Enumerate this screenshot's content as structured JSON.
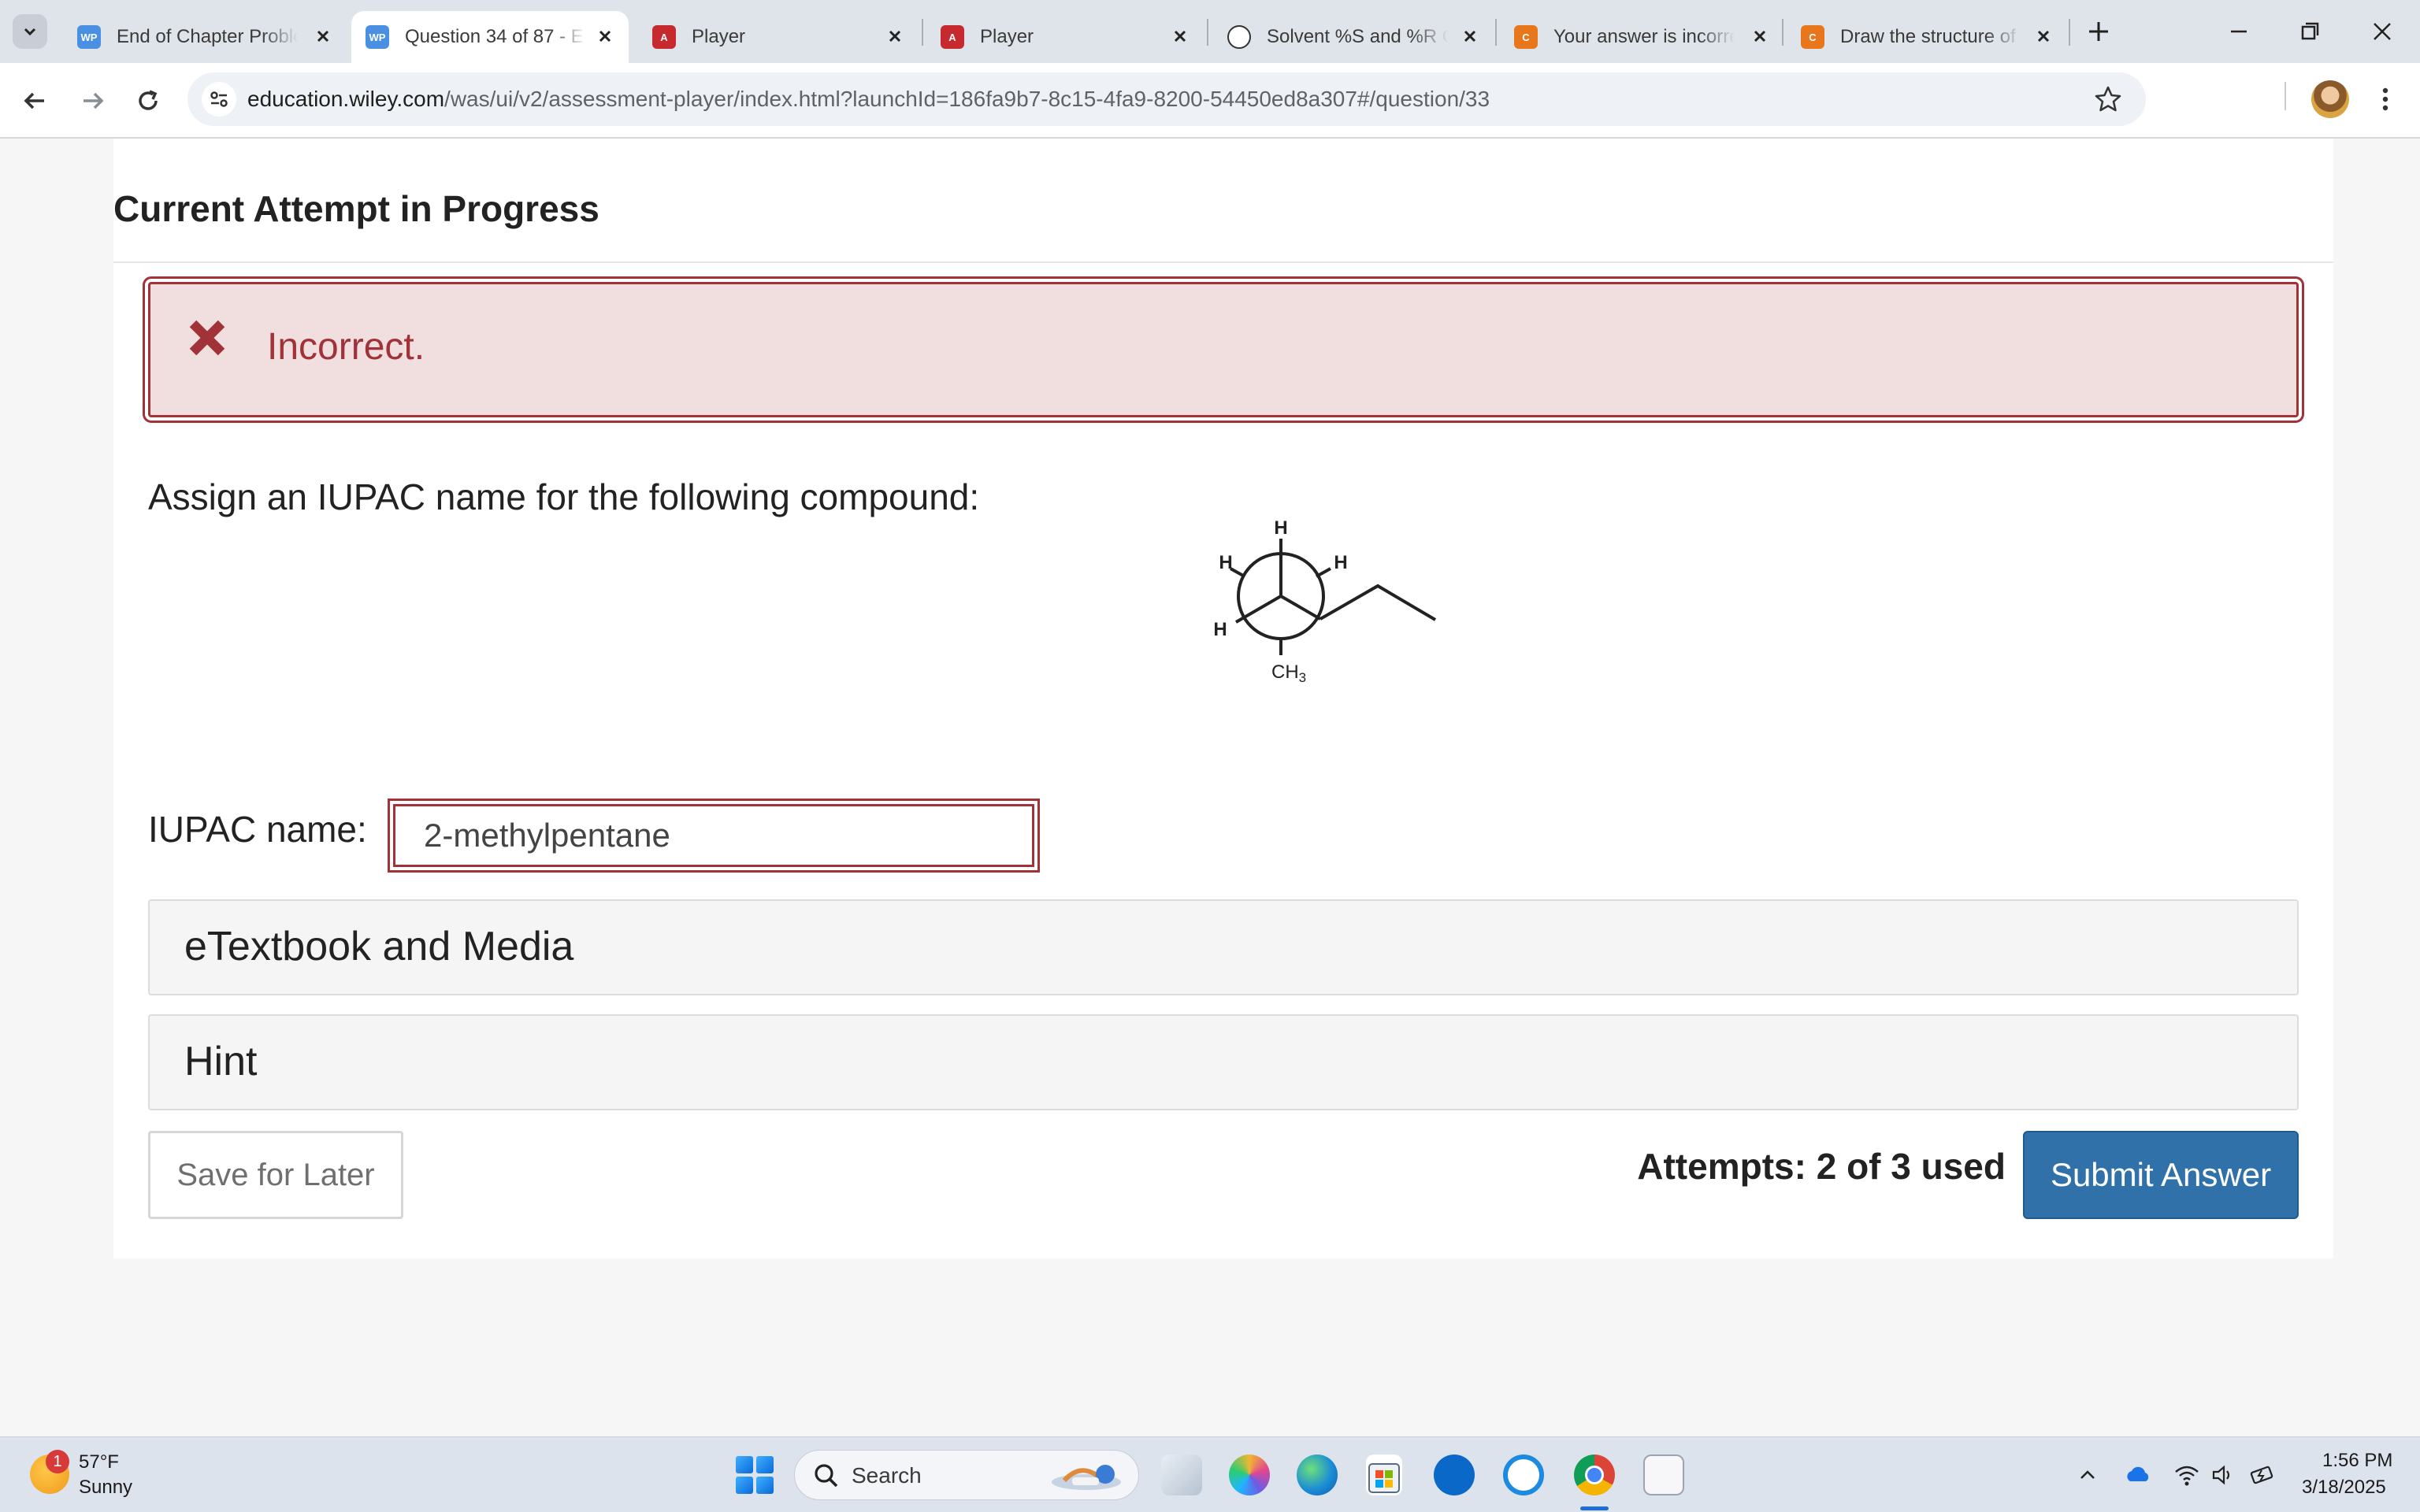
{
  "browser": {
    "tabs": [
      {
        "title": "End of Chapter Problems",
        "favicon": "WP",
        "favicon_color": "#4a90e2"
      },
      {
        "title": "Question 34 of 87 - E",
        "favicon": "WP",
        "favicon_color": "#4a90e2"
      },
      {
        "title": "Player",
        "favicon": "A",
        "favicon_color": "#c62a2f"
      },
      {
        "title": "Player",
        "favicon": "A",
        "favicon_color": "#c62a2f"
      },
      {
        "title": "Solvent %S and %R C",
        "favicon": "openai-icon",
        "favicon_color": "#333333"
      },
      {
        "title": "Your answer is incorrect",
        "favicon": "C",
        "favicon_color": "#e8761b"
      },
      {
        "title": "Draw the structure of",
        "favicon": "C",
        "favicon_color": "#e8761b"
      }
    ],
    "active_tab_index": 1,
    "url_host": "education.wiley.com",
    "url_path": "/was/ui/v2/assessment-player/index.html?launchId=186fa9b7-8c15-4fa9-8200-54450ed8a307#/question/33"
  },
  "page": {
    "attempt_heading": "Current Attempt in Progress",
    "feedback": "Incorrect.",
    "question": "Assign an IUPAC name for the following compound:",
    "molecule": {
      "front_top": "H",
      "front_left": "H",
      "front_bottom": "CH",
      "front_bottom_sub": "3",
      "back_left": "H",
      "back_right": "H"
    },
    "iupac_label": "IUPAC name:",
    "iupac_value": "2-methylpentane",
    "panels": {
      "etextbook": "eTextbook and Media",
      "hint": "Hint"
    },
    "save_label": "Save for Later",
    "attempts": "Attempts: 2 of 3 used",
    "submit_label": "Submit Answer"
  },
  "taskbar": {
    "weather_badge": "1",
    "weather_temp": "57°F",
    "weather_cond": "Sunny",
    "search_label": "Search",
    "time": "1:56 PM",
    "date": "3/18/2025"
  },
  "colors": {
    "error": "#a13238",
    "error_bg": "#f1dfe0",
    "primary": "#2f71a8"
  }
}
